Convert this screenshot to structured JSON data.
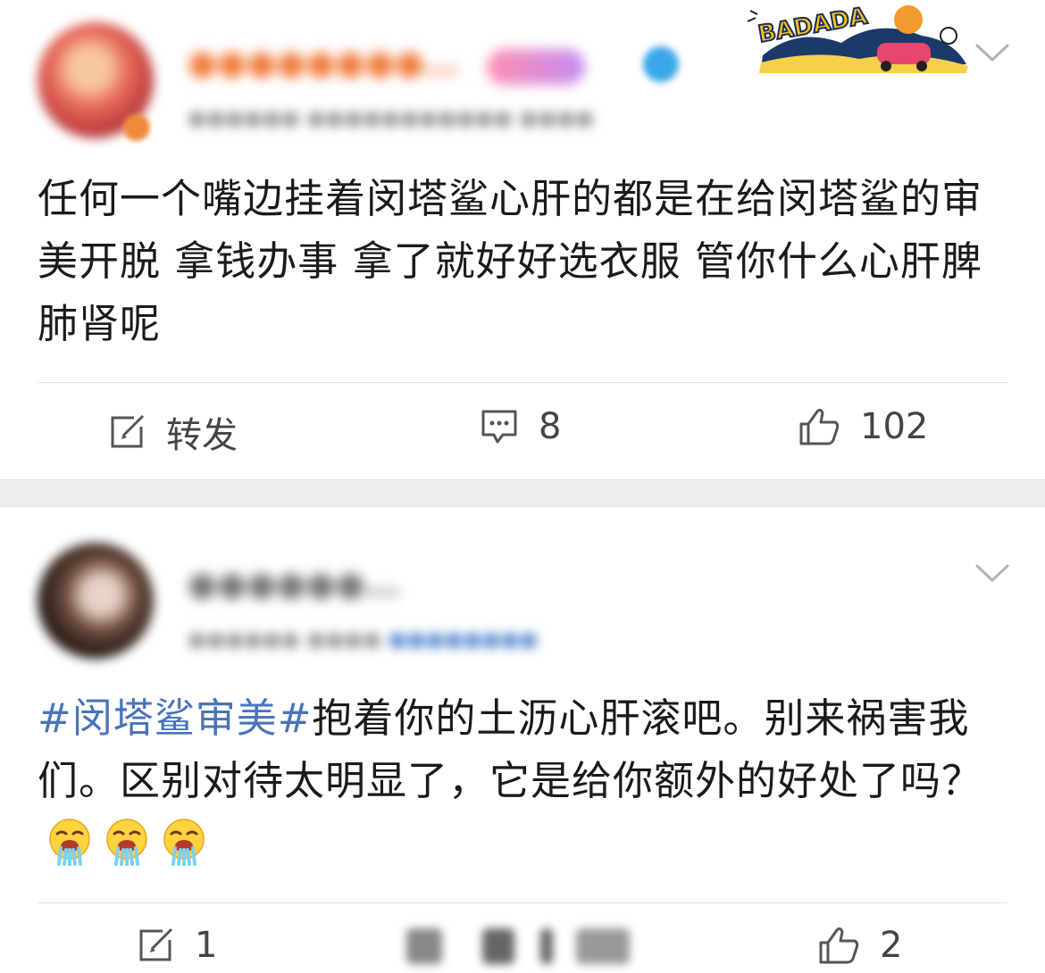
{
  "colors": {
    "topic_link": "#4a74b8",
    "text": "#1a1a1a",
    "action_text": "#444444",
    "separator": "#eeeeee"
  },
  "posts": [
    {
      "avatar_icon": "user-avatar",
      "content": "任何一个嘴边挂着闵塔鲨心肝的都是在给闵塔鲨的审美开脱 拿钱办事 拿了就好好选衣服 管你什么心肝脾肺肾呢",
      "badge_text": "BADADA",
      "actions": {
        "repost_label": "转发",
        "comment_count": "8",
        "like_count": "102"
      }
    },
    {
      "avatar_icon": "user-avatar",
      "topic": "#闵塔鲨审美#",
      "content": "抱着你的土沥心肝滚吧。别来祸害我们。区别对待太明显了，它是给你额外的好处了吗？",
      "emojis": [
        "vomit-emoji",
        "vomit-emoji",
        "vomit-emoji"
      ],
      "actions": {
        "repost_count": "1",
        "like_count": "2"
      }
    }
  ]
}
